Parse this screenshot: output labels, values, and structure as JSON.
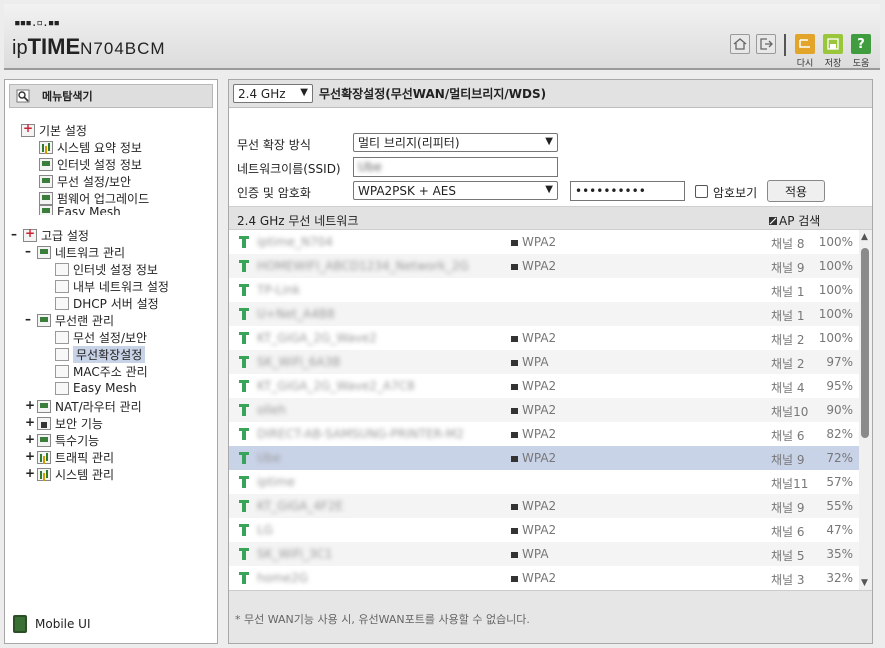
{
  "header": {
    "logo_dots": "▪▪▪.▫.▪▪",
    "logo_brand_a": "ip",
    "logo_brand_b": "TIME",
    "logo_model": "N704BCM",
    "buttons": [
      {
        "label": "다시",
        "color": "#e3a42a",
        "icon": "undo-icon"
      },
      {
        "label": "저장",
        "color": "#9ac63c",
        "icon": "save-icon"
      },
      {
        "label": "도움",
        "color": "#3f9c3f",
        "icon": "help-icon"
      }
    ]
  },
  "sidebar": {
    "title": "메뉴탐색기",
    "basic": {
      "label": "기본 설정",
      "items": [
        "시스템 요약 정보",
        "인터넷 설정 정보",
        "무선 설정/보안",
        "펌웨어 업그레이드",
        "Easy Mesh"
      ]
    },
    "advanced": {
      "label": "고급 설정",
      "network": {
        "label": "네트워크 관리",
        "items": [
          "인터넷 설정 정보",
          "내부 네트워크 설정",
          "DHCP 서버 설정"
        ]
      },
      "wireless": {
        "label": "무선랜 관리",
        "items": [
          "무선 설정/보안",
          "무선확장설정",
          "MAC주소 관리",
          "Easy Mesh"
        ]
      },
      "others": [
        "NAT/라우터 관리",
        "보안 기능",
        "특수기능",
        "트래픽 관리",
        "시스템 관리"
      ]
    },
    "mobile": "Mobile UI"
  },
  "main": {
    "band": "2.4 GHz",
    "title": "무선확장설정(무선WAN/멀티브리지/WDS)",
    "form": {
      "mode_label": "무선 확장 방식",
      "mode_value": "멀티 브리지(리피터)",
      "ssid_label": "네트워크이름(SSID)",
      "ssid_value": "Ube",
      "auth_label": "인증 및 암호화",
      "auth_value": "WPA2PSK + AES",
      "password_value": "••••••••••",
      "show_password_label": "암호보기",
      "apply_label": "적용"
    },
    "network_header": "2.4 GHz 무선 네트워크",
    "scan_label": "AP 검색",
    "networks": [
      {
        "ssid": "iptime_N704",
        "security": "WPA2",
        "channel": "채널 8",
        "signal": "100%"
      },
      {
        "ssid": "HOMEWIFI_ABCD1234_Network_2G",
        "security": "WPA2",
        "channel": "채널 9",
        "signal": "100%"
      },
      {
        "ssid": "TP-Link",
        "security": "",
        "channel": "채널 1",
        "signal": "100%"
      },
      {
        "ssid": "U+Net_A4B8",
        "security": "",
        "channel": "채널 1",
        "signal": "100%"
      },
      {
        "ssid": "KT_GiGA_2G_Wave2",
        "security": "WPA2",
        "channel": "채널 2",
        "signal": "100%"
      },
      {
        "ssid": "SK_WiFi_6A3B",
        "security": "WPA",
        "channel": "채널 2",
        "signal": "97%"
      },
      {
        "ssid": "KT_GiGA_2G_Wave2_A7C8",
        "security": "WPA2",
        "channel": "채널 4",
        "signal": "95%"
      },
      {
        "ssid": "olleh",
        "security": "WPA2",
        "channel": "채널10",
        "signal": "90%"
      },
      {
        "ssid": "DIRECT-AB-SAMSUNG-PRINTER-M2",
        "security": "WPA2",
        "channel": "채널 6",
        "signal": "82%"
      },
      {
        "ssid": "Ube",
        "security": "WPA2",
        "channel": "채널 9",
        "signal": "72%",
        "selected": true
      },
      {
        "ssid": "iptime",
        "security": "",
        "channel": "채널11",
        "signal": "57%"
      },
      {
        "ssid": "KT_GiGA_4F2E",
        "security": "WPA2",
        "channel": "채널 9",
        "signal": "55%"
      },
      {
        "ssid": "LG",
        "security": "WPA2",
        "channel": "채널 6",
        "signal": "47%"
      },
      {
        "ssid": "SK_WiFi_3C1",
        "security": "WPA",
        "channel": "채널 5",
        "signal": "35%"
      },
      {
        "ssid": "home2G",
        "security": "WPA2",
        "channel": "채널 3",
        "signal": "32%"
      }
    ],
    "footer_note": "* 무선 WAN기능 사용 시, 유선WAN포트를 사용할 수 없습니다."
  }
}
